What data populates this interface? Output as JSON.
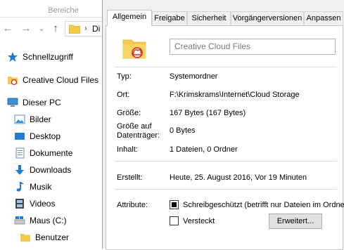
{
  "explorer": {
    "ribbon_tab": "Bereiche",
    "nav": {
      "back": "←",
      "forward": "→",
      "dropdown": "⌄",
      "up": "↑"
    },
    "address_sep": "›",
    "address_text": "Di",
    "nav_items": [
      {
        "label": "Schnellzugriff",
        "icon": "star-icon"
      },
      {
        "label": "Creative Cloud Files",
        "icon": "creative-cloud-folder-icon"
      },
      {
        "label": "Dieser PC",
        "icon": "pc-icon"
      },
      {
        "label": "Bilder",
        "icon": "pictures-icon"
      },
      {
        "label": "Desktop",
        "icon": "desktop-icon"
      },
      {
        "label": "Dokumente",
        "icon": "documents-icon"
      },
      {
        "label": "Downloads",
        "icon": "download-icon"
      },
      {
        "label": "Musik",
        "icon": "music-icon"
      },
      {
        "label": "Videos",
        "icon": "videos-icon"
      },
      {
        "label": "Maus (C:)",
        "icon": "drive-icon"
      },
      {
        "label": "Benutzer",
        "icon": "folder-icon"
      }
    ]
  },
  "dialog": {
    "tabs": [
      "Allgemein",
      "Freigabe",
      "Sicherheit",
      "Vorgängerversionen",
      "Anpassen"
    ],
    "active_tab": "Allgemein",
    "name": "Creative Cloud Files",
    "props": {
      "typ_label": "Typ:",
      "typ_value": "Systemordner",
      "ort_label": "Ort:",
      "ort_value": "F:\\Krimskrams\\Internet\\Cloud Storage",
      "groesse_label": "Größe:",
      "groesse_value": "167 Bytes (167 Bytes)",
      "datentraeger_label_1": "Größe auf",
      "datentraeger_label_2": "Datenträger:",
      "datentraeger_value": "0 Bytes",
      "inhalt_label": "Inhalt:",
      "inhalt_value": "1 Dateien, 0 Ordner",
      "erstellt_label": "Erstellt:",
      "erstellt_value": "Heute, 25. August 2016, Vor 19 Minuten",
      "attribute_label": "Attribute:",
      "readonly_label": "Schreibgeschützt (betrifft nur Dateien im Ordner)",
      "readonly_state": "indeterminate",
      "hidden_label": "Versteckt",
      "hidden_state": "unchecked",
      "advanced_button": "Erweitert..."
    }
  },
  "colors": {
    "folder": "#f5c94a",
    "cc_red": "#d6281f",
    "accent_blue": "#1e7bd6"
  }
}
